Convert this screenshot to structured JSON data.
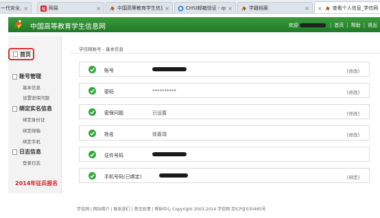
{
  "browser": {
    "tabs": [
      {
        "title": "一代安全上网",
        "icon": "browser-icon",
        "close": "×"
      },
      {
        "title": "网易",
        "icon": "netease-icon",
        "close": "×"
      },
      {
        "title": "中国高等教育学生信息网",
        "icon": "chsi-icon",
        "close": "×"
      },
      {
        "title": "CHSI邮箱验证 - qq邮箱",
        "icon": "qq-icon",
        "close": "×"
      },
      {
        "title": "学籍档案",
        "icon": "chsi-icon",
        "close": "×"
      },
      {
        "title": "查看个人信息_学信网",
        "icon": "chsi-icon",
        "close": "×"
      }
    ]
  },
  "header": {
    "title": "中国高等教育学生信息网",
    "welcome": "欢迎",
    "links": [
      "首页",
      "帮助",
      "退出"
    ]
  },
  "sidebar": {
    "home": "首页",
    "groups": [
      {
        "title": "账号管理",
        "items": [
          "基本信息",
          "设置密保问题"
        ]
      },
      {
        "title": "绑定实名信息",
        "items": [
          "绑定身份证",
          "绑定邮箱",
          "绑定手机"
        ]
      },
      {
        "title": "日志信息",
        "items": [
          "登录日志"
        ]
      }
    ],
    "promo": "2014年征兵报名"
  },
  "main": {
    "breadcrumb": "学信网账号 - 基本信息",
    "rows": [
      {
        "label": "账号",
        "value": "",
        "blurred": true,
        "edit": "[修改]"
      },
      {
        "label": "密码",
        "value": "**********",
        "blurred": false,
        "edit": "[修改]"
      },
      {
        "label": "密保问题",
        "value": "已设置",
        "blurred": false,
        "edit": "[修改]"
      },
      {
        "label": "姓名",
        "value": "徐嘉瑞",
        "blurred": false,
        "edit": "[修改]"
      },
      {
        "label": "证件号码",
        "value": "",
        "blurred": true,
        "edit": ""
      },
      {
        "label": "手机号码(已绑定)",
        "value": "",
        "blurred": true,
        "edit": "[绑定]"
      }
    ]
  },
  "footer": "学信网 | 网站简介 | 联系我们 | 意见反馈 | 帮助中心 Copyright 2003-2014 学信网 京ICP证030485号",
  "colors": {
    "header_green": "#1f7a26",
    "check_green": "#2fa93a",
    "highlight_red": "#e12a2a",
    "promo_red": "#d42020"
  }
}
